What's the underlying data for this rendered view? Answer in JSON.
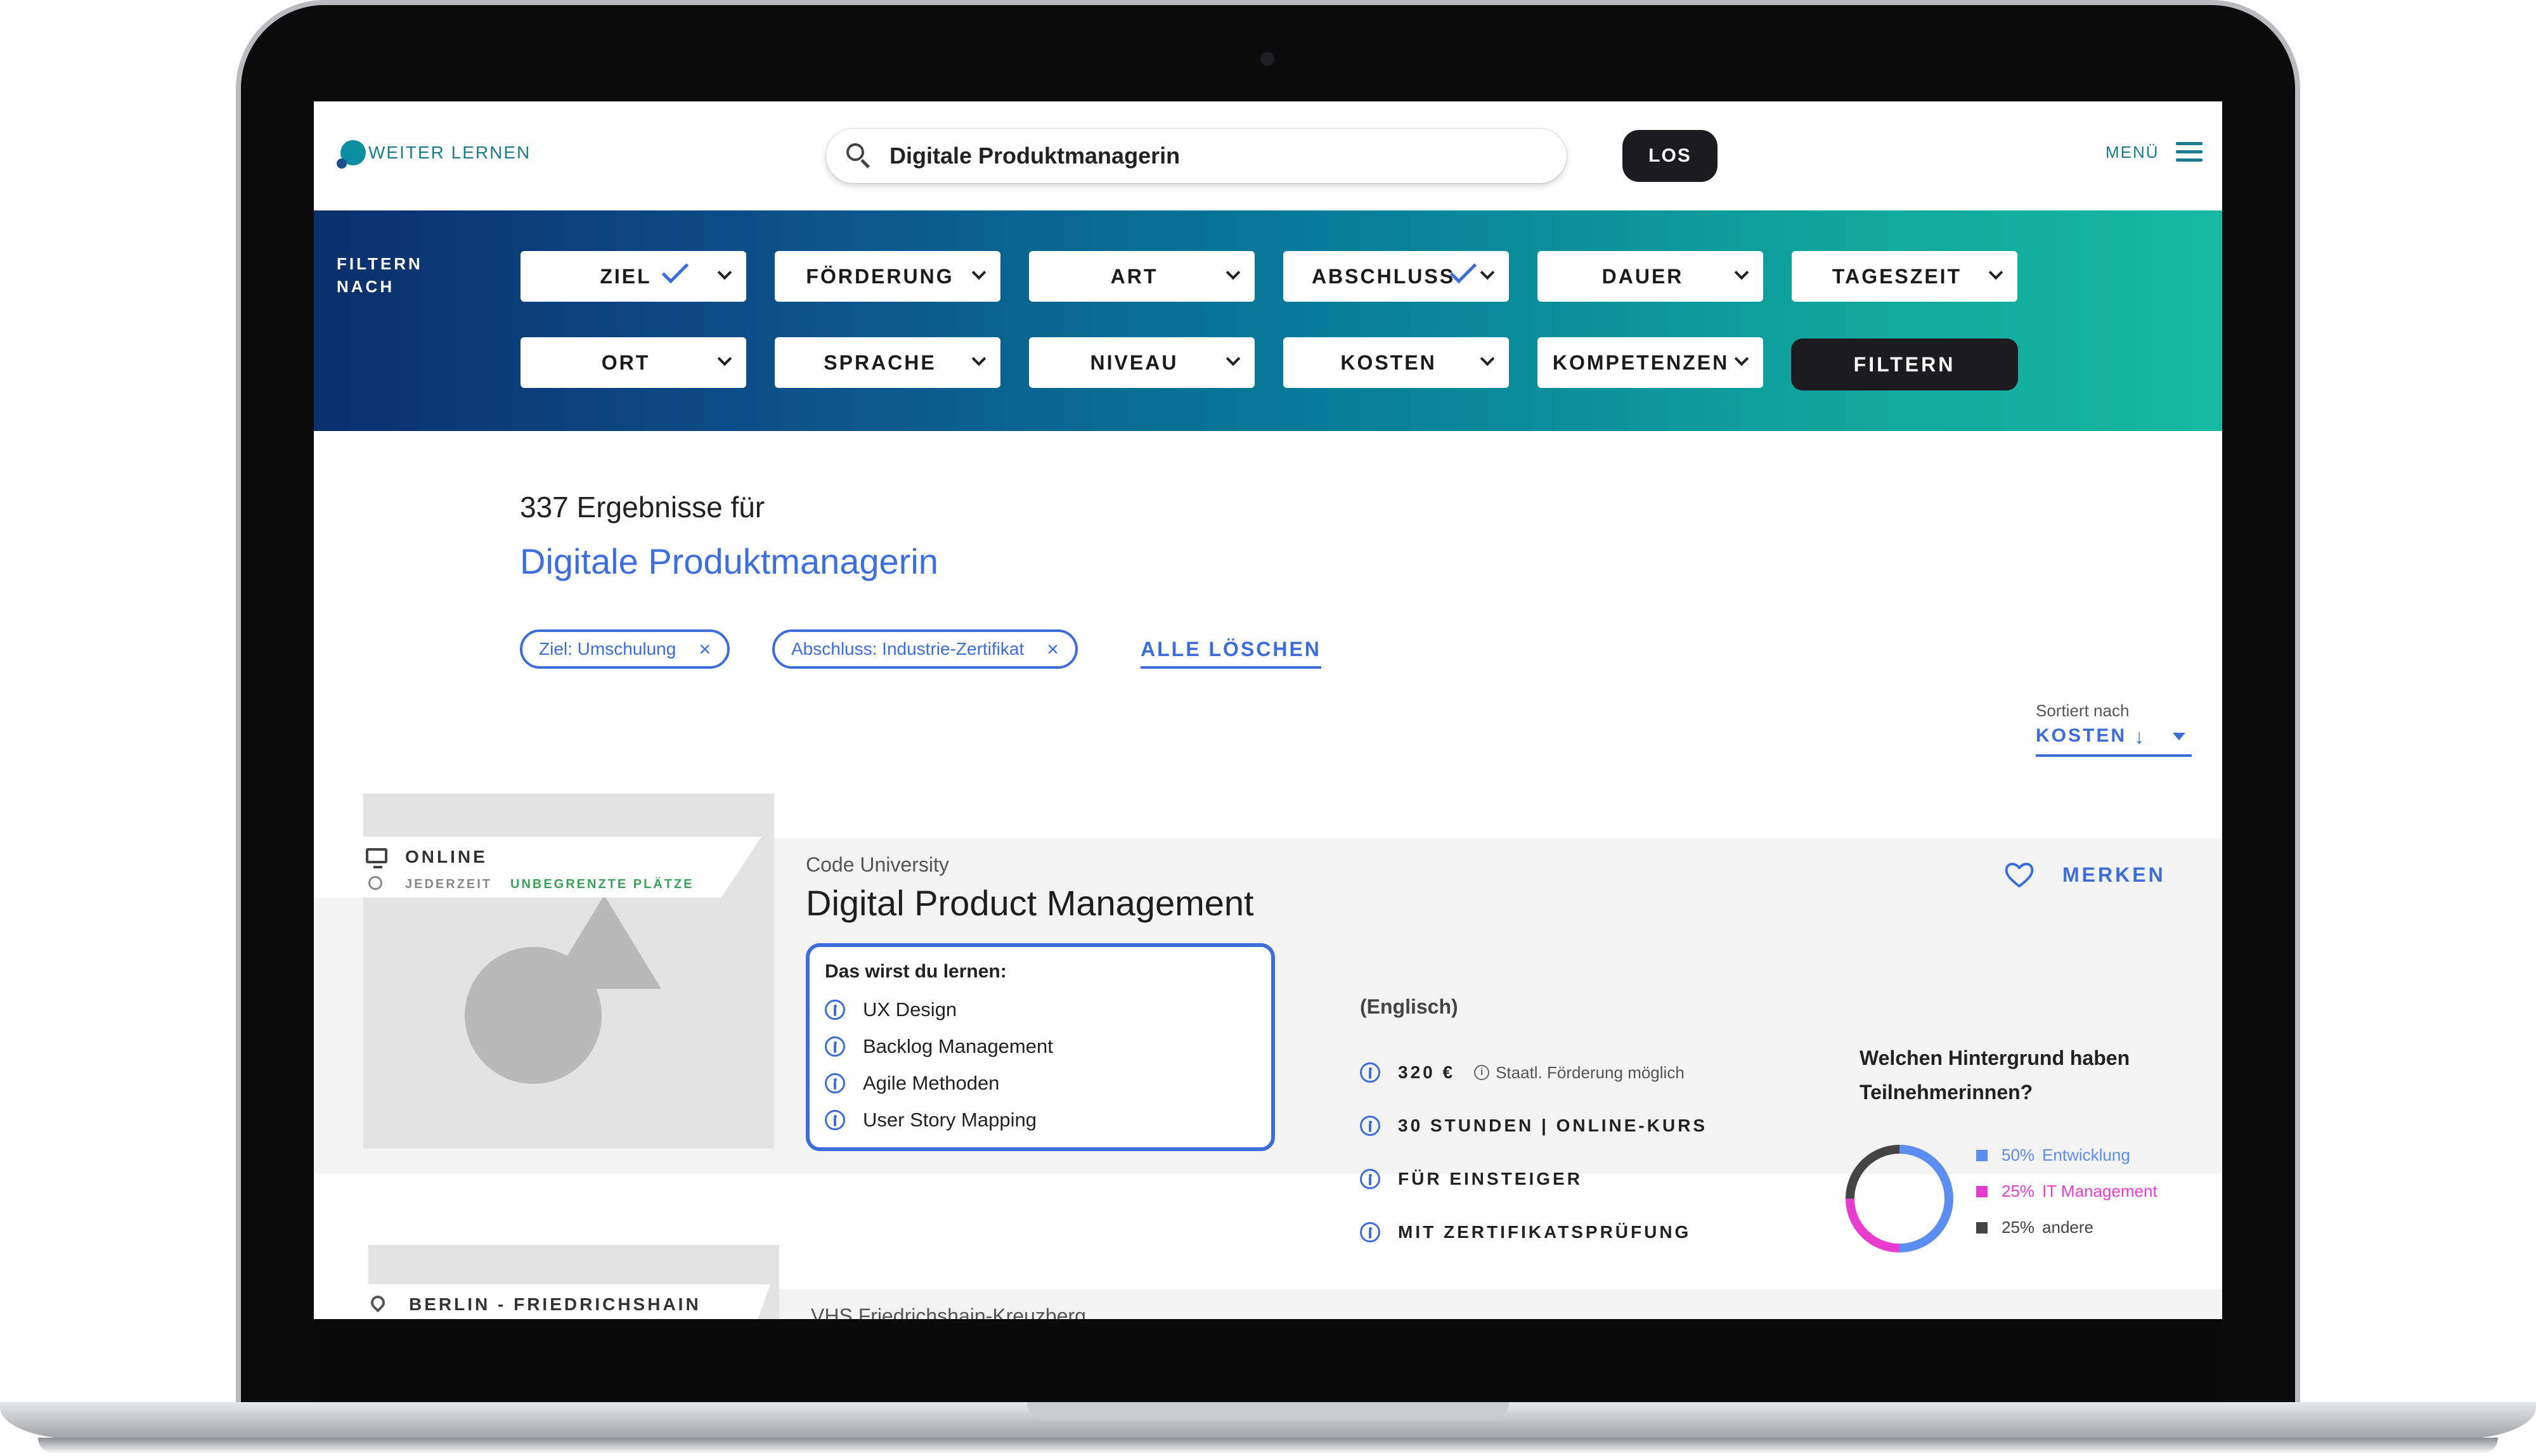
{
  "header": {
    "logo_text": "WEITER LERNEN",
    "search_value": "Digitale Produktmanagerin",
    "search_button": "LOS",
    "menu_label": "MENÜ"
  },
  "filters": {
    "title_line1": "FILTERN",
    "title_line2": "NACH",
    "row1": [
      "ZIEL",
      "FÖRDERUNG",
      "ART",
      "ABSCHLUSS",
      "DAUER",
      "TAGESZEIT"
    ],
    "row2": [
      "ORT",
      "SPRACHE",
      "NIVEAU",
      "KOSTEN",
      "KOMPETENZEN"
    ],
    "checked": [
      "ZIEL",
      "ABSCHLUSS"
    ],
    "apply_button": "FILTERN"
  },
  "results": {
    "count_text": "337 Ergebnisse für",
    "query": "Digitale Produktmanagerin",
    "chips": [
      "Ziel: Umschulung",
      "Abschluss: Industrie-Zertifikat"
    ],
    "clear_all": "ALLE LÖSCHEN",
    "sort_label": "Sortiert nach",
    "sort_value": "KOSTEN"
  },
  "course1": {
    "badge_title": "ONLINE",
    "badge_sub": "JEDERZEIT",
    "badge_places": "UNBEGRENZTE PLÄTZE",
    "provider": "Code University",
    "title": "Digital Product Management",
    "learn_title": "Das wirst du lernen:",
    "learn_items": [
      "UX Design",
      "Backlog Management",
      "Agile Methoden",
      "User Story Mapping"
    ],
    "language": "(Englisch)",
    "facts": [
      "320 €",
      "30 STUNDEN | ONLINE-KURS",
      "FÜR EINSTEIGER",
      "MIT ZERTIFIKATSPRÜFUNG"
    ],
    "funding_note": "Staatl. Förderung möglich",
    "favorite_label": "MERKEN",
    "background_question": "Welchen Hintergrund haben Teilnehmerinnen?",
    "background_stats": [
      {
        "percent": 50,
        "label": "50%",
        "name": "Entwicklung",
        "color": "#5b8ef0"
      },
      {
        "percent": 25,
        "label": "25%",
        "name": "IT Management",
        "color": "#e83ccf"
      },
      {
        "percent": 25,
        "label": "25%",
        "name": "andere",
        "color": "#444444"
      }
    ]
  },
  "course2": {
    "badge_title": "BERLIN - FRIEDRICHSHAIN",
    "provider": "VHS Friedrichshain-Kreuzberg"
  },
  "colors": {
    "accent": "#3c6ddb",
    "teal": "#1a7c8c",
    "dark_button": "#1c1c1e"
  }
}
